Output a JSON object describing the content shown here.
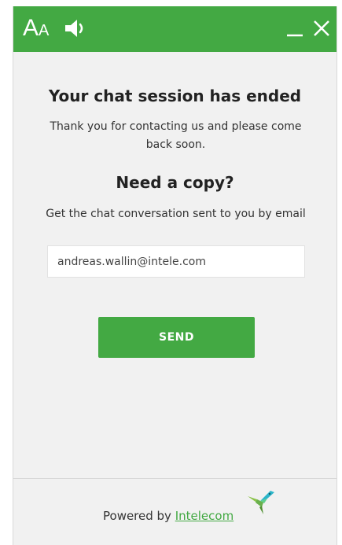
{
  "header": {
    "font_size_big": "A",
    "font_size_small": "A",
    "speaker_icon": "speaker-icon",
    "minimize_icon": "minimize-icon",
    "close_icon": "close-icon"
  },
  "content": {
    "title": "Your chat session has ended",
    "subtitle": "Thank you for contacting us and please come back soon.",
    "copy_title": "Need a copy?",
    "copy_subtitle": "Get the chat conversation sent to you by email",
    "email_value": "andreas.wallin@intele.com",
    "send_label": "SEND"
  },
  "footer": {
    "powered_prefix": "Powered by ",
    "brand_link": "Intelecom",
    "brand_icon": "hummingbird-logo-icon"
  },
  "colors": {
    "accent": "#43a943",
    "background": "#f1f1f1",
    "text": "#333333"
  }
}
